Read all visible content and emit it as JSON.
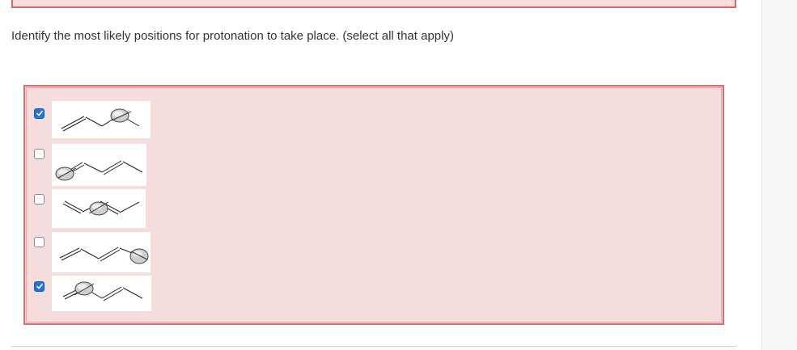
{
  "question": {
    "text": "Identify the most likely positions for protonation to take place. (select all that apply)"
  },
  "options": [
    {
      "id": "option-1",
      "checked": true,
      "molecule": "molecule-1"
    },
    {
      "id": "option-2",
      "checked": false,
      "molecule": "molecule-2"
    },
    {
      "id": "option-3",
      "checked": false,
      "molecule": "molecule-3"
    },
    {
      "id": "option-4",
      "checked": false,
      "molecule": "molecule-4"
    },
    {
      "id": "option-5",
      "checked": true,
      "molecule": "molecule-5"
    }
  ],
  "colors": {
    "answer_box_bg": "#f5dcdd",
    "answer_box_border": "#d47070",
    "checkbox_checked": "#2a6fd6"
  }
}
